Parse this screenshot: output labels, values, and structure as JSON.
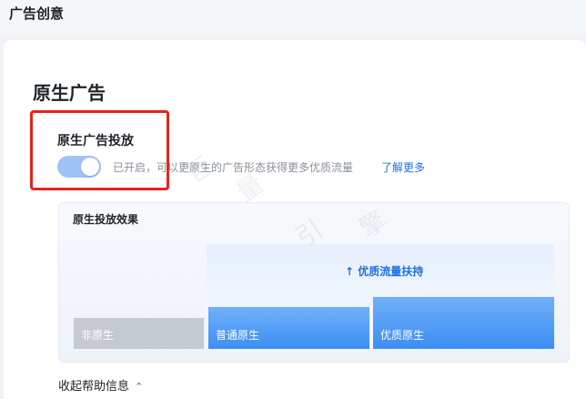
{
  "page": {
    "section_title": "广告创意"
  },
  "native_ads": {
    "heading": "原生广告",
    "toggle": {
      "label": "原生广告投放",
      "enabled": true
    },
    "description": "已开启，可以更原生的广告形态获得更多优质流量",
    "learn_more": "了解更多"
  },
  "effect": {
    "title": "原生投放效果",
    "boost_label": "↑ 优质流量扶持",
    "bars": [
      {
        "label": "非原生",
        "level": 0.29
      },
      {
        "label": "普通原生",
        "level": 0.4
      },
      {
        "label": "优质原生",
        "level": 0.5
      }
    ],
    "colors": {
      "non_native": "#c5c9d0",
      "native": "#3d8ef3"
    }
  },
  "help": {
    "collapse_label": "收起帮助信息",
    "chevron": "chevrons-up-icon"
  },
  "watermark": [
    "巨",
    "量",
    "引",
    "擎"
  ]
}
